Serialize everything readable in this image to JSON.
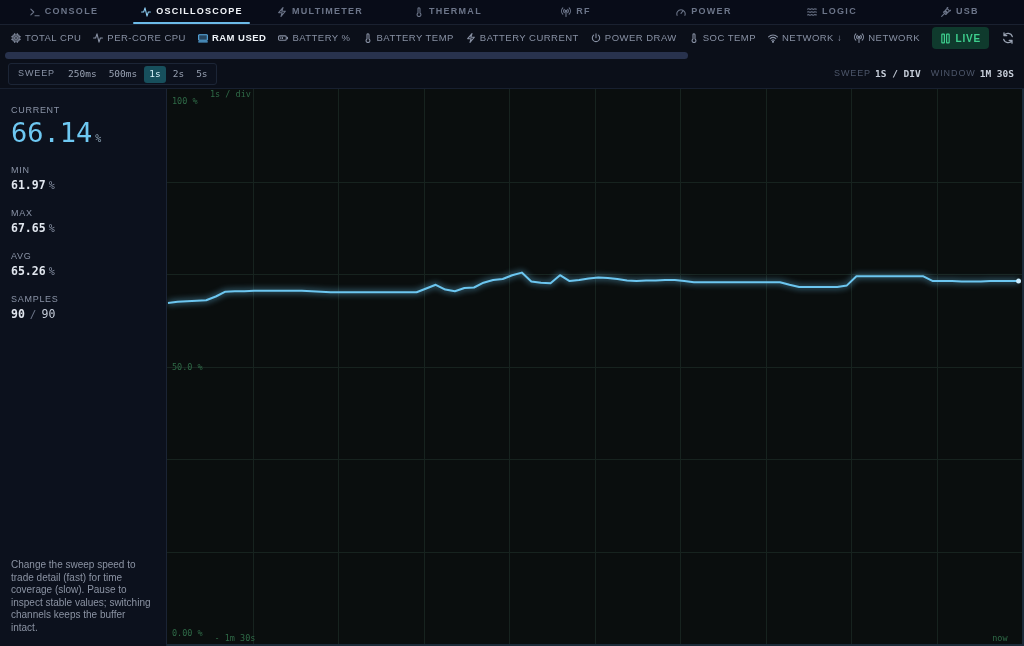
{
  "tabs": [
    {
      "label": "CONSOLE",
      "selected": false
    },
    {
      "label": "OSCILLOSCOPE",
      "selected": true
    },
    {
      "label": "MULTIMETER",
      "selected": false
    },
    {
      "label": "THERMAL",
      "selected": false
    },
    {
      "label": "RF",
      "selected": false
    },
    {
      "label": "POWER",
      "selected": false
    },
    {
      "label": "LOGIC",
      "selected": false
    },
    {
      "label": "USB",
      "selected": false
    }
  ],
  "channels": [
    {
      "label": "TOTAL CPU",
      "selected": false
    },
    {
      "label": "PER-CORE CPU",
      "selected": false
    },
    {
      "label": "RAM USED",
      "selected": true
    },
    {
      "label": "BATTERY %",
      "selected": false
    },
    {
      "label": "BATTERY TEMP",
      "selected": false
    },
    {
      "label": "BATTERY CURRENT",
      "selected": false
    },
    {
      "label": "POWER DRAW",
      "selected": false
    },
    {
      "label": "SOC TEMP",
      "selected": false
    },
    {
      "label": "NETWORK ↓",
      "selected": false
    },
    {
      "label": "NETWORK",
      "selected": false
    }
  ],
  "live_button": {
    "label": "LIVE",
    "active": true
  },
  "sweep": {
    "label": "SWEEP",
    "options": [
      {
        "label": "250ms",
        "selected": false
      },
      {
        "label": "500ms",
        "selected": false
      },
      {
        "label": "1s",
        "selected": true
      },
      {
        "label": "2s",
        "selected": false
      },
      {
        "label": "5s",
        "selected": false
      }
    ]
  },
  "readout": [
    {
      "label": "SWEEP",
      "value": "1S / DIV"
    },
    {
      "label": "WINDOW",
      "value": "1M 30S"
    }
  ],
  "stats": {
    "current": {
      "label": "CURRENT",
      "value": "66.14",
      "unit": "%"
    },
    "items": [
      {
        "label": "MIN",
        "value": "61.97",
        "unit": "%"
      },
      {
        "label": "MAX",
        "value": "67.65",
        "unit": "%"
      },
      {
        "label": "AVG",
        "value": "65.26",
        "unit": "%"
      }
    ],
    "samples": {
      "label": "SAMPLES",
      "value": "90",
      "separator": "/",
      "total": "90"
    }
  },
  "help_text": "Change the sweep speed to trade detail (fast) for time coverage (slow). Pause to inspect stable values; switching channels keeps the buffer intact.",
  "chart": {
    "chart_data": {
      "type": "line",
      "categories": [
        null,
        null,
        null,
        null,
        null,
        null,
        null,
        "- 1m 30s",
        null,
        null,
        null,
        null,
        null,
        null,
        null,
        null,
        null,
        null,
        null,
        null,
        null,
        null,
        null,
        null,
        null,
        null,
        null,
        null,
        null,
        null,
        null,
        null,
        null,
        null,
        null,
        null,
        null,
        null,
        null,
        null,
        null,
        null,
        null,
        null,
        null,
        null,
        null,
        null,
        null,
        null,
        null,
        null,
        null,
        null,
        null,
        null,
        null,
        null,
        null,
        null,
        null,
        null,
        null,
        null,
        null,
        null,
        null,
        null,
        null,
        null,
        null,
        null,
        null,
        null,
        null,
        null,
        null,
        null,
        null,
        null,
        null,
        null,
        null,
        null,
        null,
        null,
        null,
        "now",
        null,
        null
      ],
      "ylim": [
        -2.1,
        102.2
      ],
      "yticks": [
        {
          "value": 0,
          "label": "0.00 %"
        },
        {
          "value": 50,
          "label": "50.0 %"
        },
        {
          "value": 100,
          "label": "100 %"
        }
      ],
      "annotations": [
        "1s / div"
      ],
      "series": [
        {
          "color": "#6cc6f0",
          "values": [
            62.0,
            62.2,
            62.3,
            62.4,
            62.5,
            63.2,
            64.1,
            64.2,
            64.2,
            64.3,
            64.3,
            64.3,
            64.3,
            64.3,
            64.3,
            64.2,
            64.1,
            64.0,
            64.0,
            64.0,
            64.0,
            64.0,
            64.0,
            64.0,
            64.0,
            64.0,
            64.0,
            64.7,
            65.4,
            64.5,
            64.2,
            64.8,
            64.9,
            65.8,
            66.3,
            66.5,
            67.2,
            67.7,
            66.0,
            65.8,
            65.7,
            67.2,
            66.1,
            66.3,
            66.6,
            66.8,
            66.7,
            66.5,
            66.2,
            66.1,
            66.2,
            66.2,
            66.3,
            66.3,
            66.1,
            65.9,
            65.9,
            65.9,
            65.9,
            65.9,
            65.9,
            65.9,
            65.9,
            65.9,
            65.9,
            65.4,
            65.0,
            65.0,
            65.0,
            65.0,
            65.0,
            65.3,
            67.0,
            67.0,
            67.0,
            67.0,
            67.0,
            67.0,
            67.0,
            67.0,
            66.1,
            66.1,
            66.1,
            66.0,
            66.0,
            66.0,
            66.1,
            66.1,
            66.1,
            66.1
          ]
        }
      ]
    }
  }
}
